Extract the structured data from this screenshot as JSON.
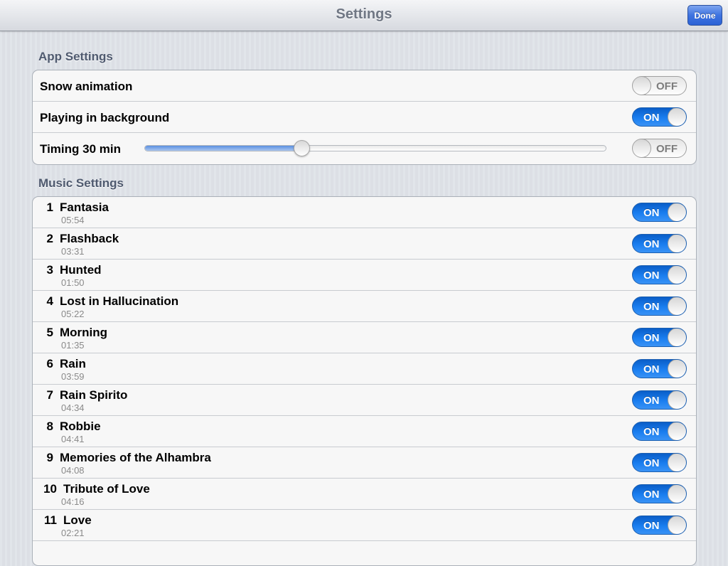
{
  "navbar": {
    "title": "Settings",
    "done_label": "Done"
  },
  "app_settings": {
    "header": "App Settings",
    "snow": {
      "label": "Snow animation",
      "toggle": "OFF"
    },
    "background": {
      "label": "Playing in background",
      "toggle": "ON"
    },
    "timing": {
      "label": "Timing 30 min",
      "slider_value": 0.34,
      "toggle": "OFF"
    }
  },
  "music_settings": {
    "header": "Music Settings",
    "tracks": [
      {
        "num": "1",
        "title": "Fantasia",
        "duration": "05:54",
        "toggle": "ON"
      },
      {
        "num": "2",
        "title": "Flashback",
        "duration": "03:31",
        "toggle": "ON"
      },
      {
        "num": "3",
        "title": "Hunted",
        "duration": "01:50",
        "toggle": "ON"
      },
      {
        "num": "4",
        "title": "Lost in Hallucination",
        "duration": "05:22",
        "toggle": "ON"
      },
      {
        "num": "5",
        "title": "Morning",
        "duration": "01:35",
        "toggle": "ON"
      },
      {
        "num": "6",
        "title": "Rain",
        "duration": "03:59",
        "toggle": "ON"
      },
      {
        "num": "7",
        "title": "Rain Spirito",
        "duration": "04:34",
        "toggle": "ON"
      },
      {
        "num": "8",
        "title": "Robbie",
        "duration": "04:41",
        "toggle": "ON"
      },
      {
        "num": "9",
        "title": "Memories of the Alhambra",
        "duration": "04:08",
        "toggle": "ON"
      },
      {
        "num": "10",
        "title": "Tribute of Love",
        "duration": "04:16",
        "toggle": "ON"
      },
      {
        "num": "11",
        "title": "Love",
        "duration": "02:21",
        "toggle": "ON"
      }
    ]
  }
}
